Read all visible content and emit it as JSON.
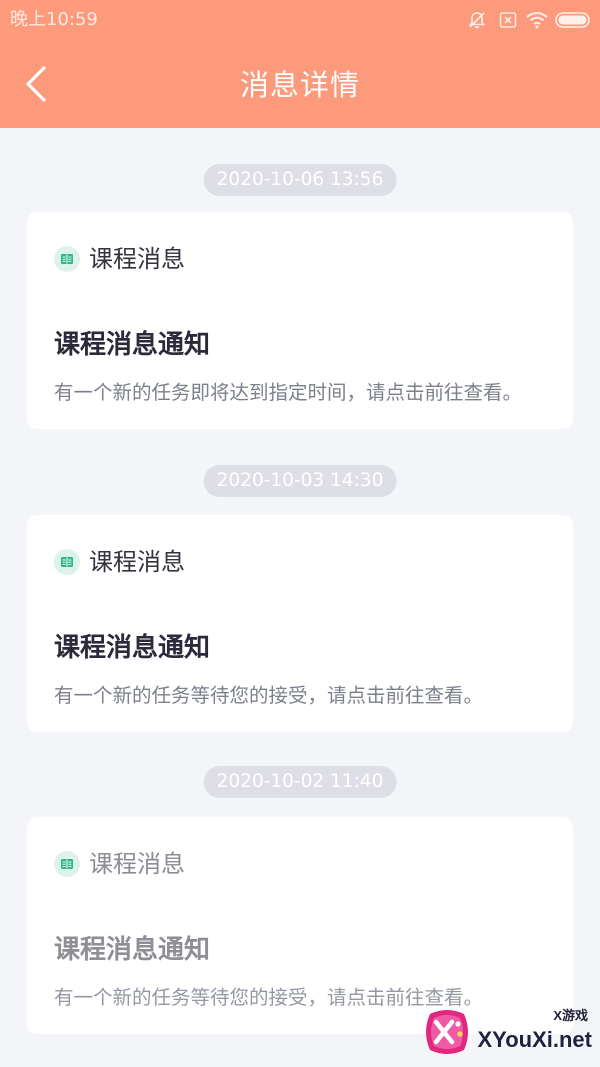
{
  "status_bar": {
    "time": "晚上10:59",
    "icons": [
      "alarm-off-icon",
      "sim-card-icon",
      "wifi-icon",
      "battery-icon"
    ]
  },
  "header": {
    "title": "消息详情",
    "back_icon": "chevron-left-icon"
  },
  "messages": [
    {
      "time": "2020-10-06 13:56",
      "category_icon": "book-icon",
      "category": "课程消息",
      "title": "课程消息通知",
      "body": "有一个新的任务即将达到指定时间，请点击前往查看。"
    },
    {
      "time": "2020-10-03 14:30",
      "category_icon": "book-icon",
      "category": "课程消息",
      "title": "课程消息通知",
      "body": "有一个新的任务等待您的接受，请点击前往查看。"
    },
    {
      "time": "2020-10-02 11:40",
      "category_icon": "book-icon",
      "category": "课程消息",
      "title": "课程消息通知",
      "body": "有一个新的任务等待您的接受，请点击前往查看。"
    }
  ],
  "watermark": {
    "brand": "X游戏",
    "site": "XYouXi.net"
  },
  "colors": {
    "header": "#FC9A7B",
    "background": "#F4F5F9",
    "card": "#FFFFFF",
    "time_pill": "#DEDFE6",
    "icon_green": "#2DB68C",
    "icon_green_bg": "#DCF2EA"
  }
}
